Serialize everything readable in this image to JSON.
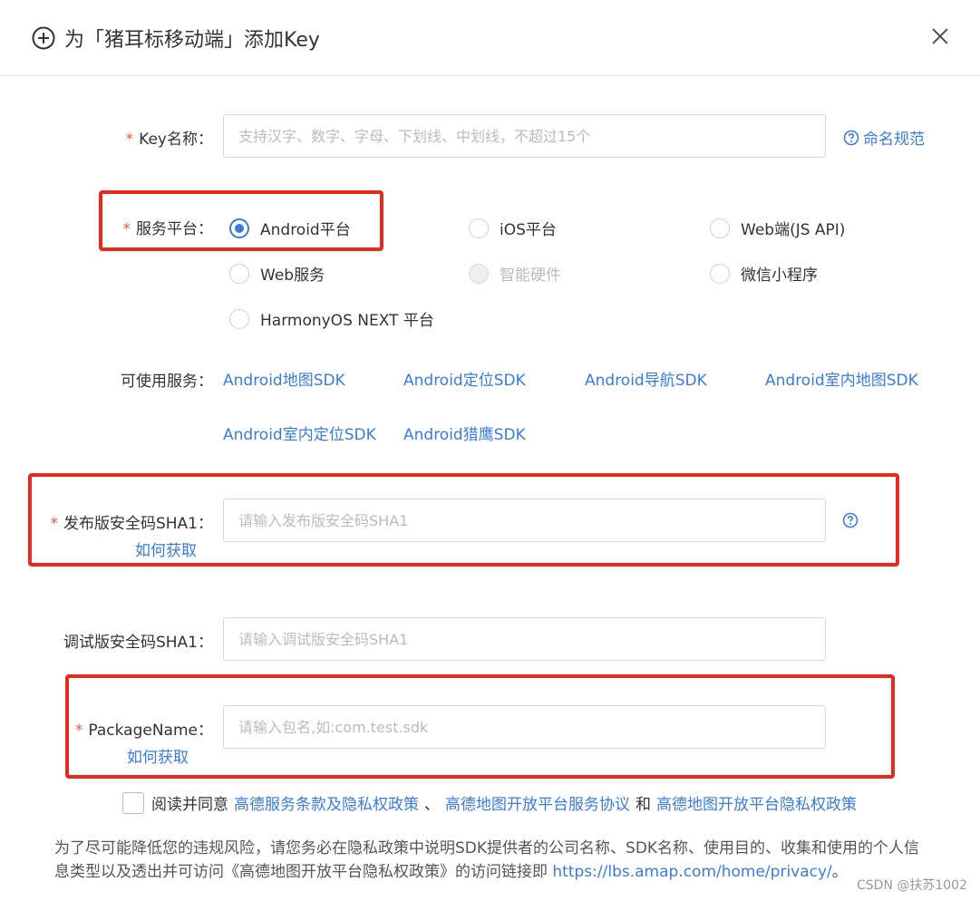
{
  "dialog": {
    "title": "为「猪耳标移动端」添加Key",
    "icons": {
      "header_icon": "plus-circle-icon",
      "close": "close-icon"
    }
  },
  "key_name": {
    "required_mark": "*",
    "label": "Key名称：",
    "placeholder": "支持汉字、数字、字母、下划线、中划线，不超过15个",
    "help_link": "命名规范"
  },
  "platform": {
    "required_mark": "*",
    "label": "服务平台：",
    "options": [
      {
        "label": "Android平台",
        "checked": true,
        "disabled": false
      },
      {
        "label": "iOS平台",
        "checked": false,
        "disabled": false
      },
      {
        "label": "Web端(JS API)",
        "checked": false,
        "disabled": false
      },
      {
        "label": "Web服务",
        "checked": false,
        "disabled": false
      },
      {
        "label": "智能硬件",
        "checked": false,
        "disabled": true
      },
      {
        "label": "微信小程序",
        "checked": false,
        "disabled": false
      },
      {
        "label": "HarmonyOS NEXT 平台",
        "checked": false,
        "disabled": false
      }
    ]
  },
  "services": {
    "label": "可使用服务：",
    "items": [
      "Android地图SDK",
      "Android定位SDK",
      "Android导航SDK",
      "Android室内地图SDK",
      "Android室内定位SDK",
      "Android猎鹰SDK"
    ]
  },
  "release_sha1": {
    "required_mark": "*",
    "label": "发布版安全码SHA1：",
    "placeholder": "请输入发布版安全码SHA1",
    "how_to_link": "如何获取"
  },
  "debug_sha1": {
    "label": "调试版安全码SHA1：",
    "placeholder": "请输入调试版安全码SHA1"
  },
  "package_name": {
    "required_mark": "*",
    "label": "PackageName：",
    "placeholder": "请输入包名,如:com.test.sdk",
    "how_to_link": "如何获取"
  },
  "agreement": {
    "prefix": "阅读并同意",
    "link1": "高德服务条款及隐私权政策",
    "sep1": "、",
    "link2": "高德地图开放平台服务协议",
    "sep2": "和",
    "link3": "高德地图开放平台隐私权政策"
  },
  "notice": {
    "text": "为了尽可能降低您的违规风险，请您务必在隐私政策中说明SDK提供者的公司名称、SDK名称、使用目的、收集和使用的个人信息类型以及透出并可访问《高德地图开放平台隐私权政策》的访问链接即",
    "url": "https://lbs.amap.com/home/privacy/",
    "suffix": "。"
  },
  "watermark": "CSDN @扶苏1002",
  "colors": {
    "accent": "#3a7be0",
    "required": "#f5543f",
    "annotation_box": "#e8291c"
  }
}
